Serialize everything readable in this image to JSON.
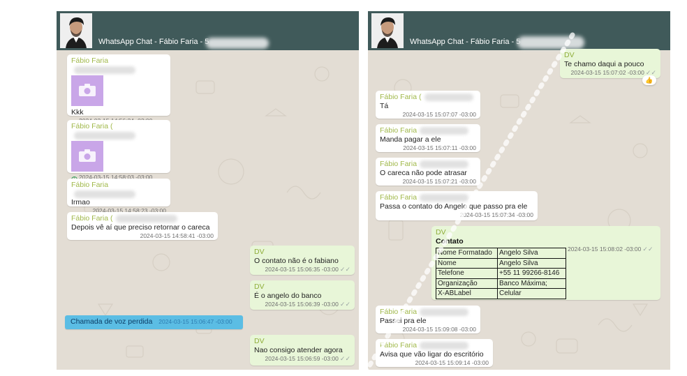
{
  "left_panel": {
    "header_title": "WhatsApp Chat - Fábio Faria - 5",
    "messages": [
      {
        "sender": "Fábio Faria",
        "text": "Kkk",
        "time": "2024-03-15 14:56:24 -03:00"
      },
      {
        "sender": "Fábio Faria (",
        "time": "2024-03-15 14:58:03 -03:00"
      },
      {
        "sender": "Fábio Faria",
        "text": "Irmao",
        "time": "2024-03-15 14:58:23 -03:00"
      },
      {
        "sender": "Fábio Faria (",
        "text": "Depois vê aí que preciso retornar o careca",
        "time": "2024-03-15 14:58:41 -03:00"
      },
      {
        "sender": "DV",
        "text": "O contato não é o fabiano",
        "time": "2024-03-15 15:06:35 -03:00"
      },
      {
        "sender": "DV",
        "text": "É o angelo do banco",
        "time": "2024-03-15 15:06:39 -03:00"
      },
      {
        "text": "Chamada de voz perdida",
        "time": "2024-03-15 15:06:47 -03:00"
      },
      {
        "sender": "DV",
        "text": "Nao consigo atender agora",
        "time": "2024-03-15 15:06:59 -03:00"
      }
    ]
  },
  "right_panel": {
    "header_title": "WhatsApp Chat - Fábio Faria - 5",
    "messages": [
      {
        "sender": "DV",
        "text": "Te chamo daqui a pouco",
        "time": "2024-03-15 15:07:02 -03:00",
        "reaction": "👍"
      },
      {
        "sender": "Fábio Faria (",
        "text": "Tá",
        "time": "2024-03-15 15:07:07 -03:00"
      },
      {
        "sender": "Fábio Faria",
        "text": "Manda pagar a ele",
        "time": "2024-03-15 15:07:11 -03:00"
      },
      {
        "sender": "Fábio Faria",
        "text": "O careca não pode atrasar",
        "time": "2024-03-15 15:07:21 -03:00"
      },
      {
        "sender": "Fábio Faria",
        "text": "Passa o contato do Angelo que passo pra ele",
        "time": "2024-03-15 15:07:34 -03:00"
      },
      {
        "sender": "DV",
        "text": "Contato",
        "time": "2024-03-15 15:08:02 -03:00",
        "contact_rows": [
          {
            "key": "Nome Formatado",
            "value": "Angelo Silva"
          },
          {
            "key": "Nome",
            "value": "Angelo Silva"
          },
          {
            "key": "Telefone",
            "value": "+55 11 99266-8146"
          },
          {
            "key": "Organização",
            "value": "Banco Máxima;"
          },
          {
            "key": "X-ABLabel",
            "value": "Celular"
          }
        ]
      },
      {
        "sender": "Fábio Faria",
        "text": "Passei pra ele",
        "time": "2024-03-15 15:09:08 -03:00"
      },
      {
        "sender": "Fábio Faria",
        "text": "Avisa que vão ligar do escritório",
        "time": "2024-03-15 15:09:14 -03:00"
      }
    ]
  },
  "colors": {
    "header": "#405a5a",
    "wallpaper": "#e3ddd4",
    "incoming_bubble": "#ffffff",
    "outgoing_bubble": "#e8f6d8",
    "missed_call_bubble": "#5bbde4",
    "sender_name": "#a0b84a",
    "photo_placeholder": "#c9a6e8"
  },
  "icons": {
    "pending": "clock-icon",
    "delivered": "double-check-icon",
    "photo": "camera-icon",
    "reaction": "thumbs-up-emoji"
  }
}
